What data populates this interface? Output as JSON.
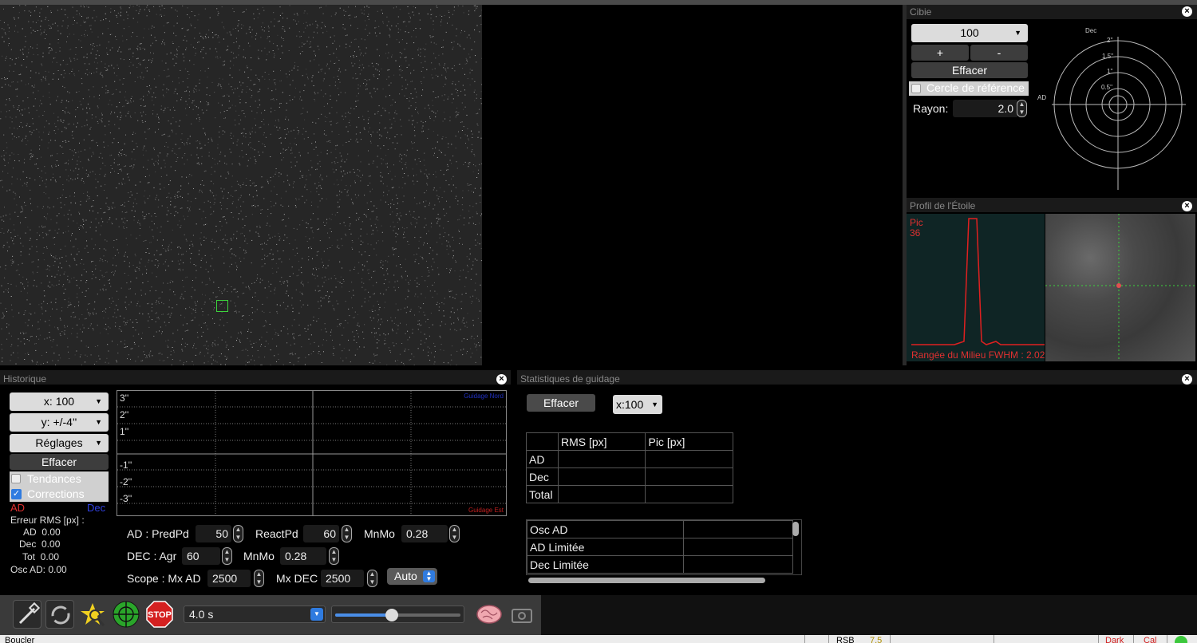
{
  "camera": {
    "roi_box_color": "#3cd43c"
  },
  "cible": {
    "title": "Cibie",
    "scale_select": "100",
    "plus_label": "+",
    "minus_label": "-",
    "clear_label": "Effacer",
    "ref_circle_label": "Cercle de référence",
    "ref_circle_checked": false,
    "radius_label": "Rayon:",
    "radius_value": "2.0",
    "axis_dec": "Dec",
    "axis_ad": "AD",
    "ring_labels": [
      "2''",
      "1.5''",
      "1''",
      "0.5''"
    ]
  },
  "star_profile": {
    "title": "Profil de l'Étoile",
    "peak_label": "Pic",
    "peak_value": "36",
    "fwhm_text": "Rangée du Milieu FWHM : 2.02"
  },
  "history": {
    "title": "Historique",
    "x_select": "x: 100",
    "y_select": "y: +/-4''",
    "settings_select": "Réglages",
    "clear_label": "Effacer",
    "trends_label": "Tendances",
    "trends_checked": false,
    "corrections_label": "Corrections",
    "corrections_checked": true,
    "legend_ra": "AD",
    "legend_dec": "Dec",
    "rms_header": "Erreur RMS [px] :",
    "rms_ra": "AD  0.00",
    "rms_dec": "Dec  0.00",
    "rms_tot": "Tot  0.00",
    "osc_ra": "Osc AD: 0.00",
    "y_ticks": [
      "3''",
      "2''",
      "1''",
      "-1''",
      "-2''",
      "-3''"
    ],
    "guide_north": "Guidage Nord",
    "guide_east": "Guidage Est",
    "ra_pred_label": "AD : PredPd",
    "ra_pred_value": "50",
    "react_label": "ReactPd",
    "react_value": "60",
    "ra_minmo_label": "MnMo",
    "ra_minmo_value": "0.28",
    "dec_agr_label": "DEC : Agr",
    "dec_agr_value": "60",
    "dec_minmo_label": "MnMo",
    "dec_minmo_value": "0.28",
    "scope_mxad_label": "Scope : Mx AD",
    "scope_mxad_value": "2500",
    "mxdec_label": "Mx DEC",
    "mxdec_value": "2500",
    "auto_label": "Auto"
  },
  "stats": {
    "title": "Statistiques de guidage",
    "clear_label": "Effacer",
    "x_select": "x:100",
    "table_headers": [
      "",
      "RMS [px]",
      "Pic [px]"
    ],
    "table_rows": [
      "AD",
      "Dec",
      "Total"
    ],
    "list_rows": [
      "Osc AD",
      "AD Limitée",
      "Dec Limitée"
    ]
  },
  "toolbar": {
    "exposure": "4.0 s",
    "slider_fraction": 0.45,
    "stop_label": "STOP"
  },
  "status": {
    "left_text": "Boucler",
    "snr_label": "RSB",
    "snr_value": "7.5",
    "dark_label": "Dark",
    "cal_label": "Cal"
  }
}
